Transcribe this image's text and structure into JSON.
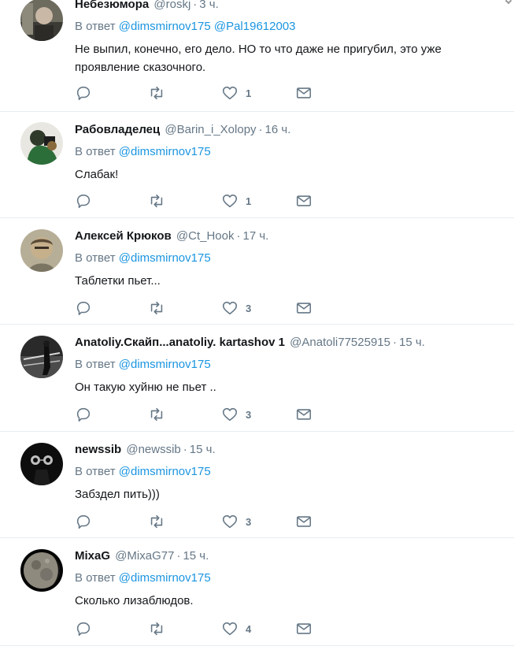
{
  "tweets": [
    {
      "name": "Небезюмора",
      "handle": "@roskj",
      "time": "3 ч.",
      "reply_prefix": "В ответ",
      "mentions": [
        "@dimsmirnov175",
        "@Pal19612003"
      ],
      "text": "Не выпил, конечно, его дело. НО то что даже не пригубил, это уже проявление сказочного.",
      "likes": "1"
    },
    {
      "name": "Рабовладелец",
      "handle": "@Barin_i_Xolopy",
      "time": "16 ч.",
      "reply_prefix": "В ответ",
      "mentions": [
        "@dimsmirnov175"
      ],
      "text": "Слабак!",
      "likes": "1"
    },
    {
      "name": "Алексей Крюков",
      "handle": "@Ct_Hook",
      "time": "17 ч.",
      "reply_prefix": "В ответ",
      "mentions": [
        "@dimsmirnov175"
      ],
      "text": "Таблетки пьет...",
      "likes": "3"
    },
    {
      "name": "Anatoliy.Скайп...anatoliy. kartashov 1",
      "handle": "@Anatoli77525915",
      "time": "15 ч.",
      "reply_prefix": "В ответ",
      "mentions": [
        "@dimsmirnov175"
      ],
      "text": "Он такую хуйню не пьет ..",
      "likes": "3"
    },
    {
      "name": "newssib",
      "handle": "@newssib",
      "time": "15 ч.",
      "reply_prefix": "В ответ",
      "mentions": [
        "@dimsmirnov175"
      ],
      "text": "Забздел пить)))",
      "likes": "3"
    },
    {
      "name": "MixaG",
      "handle": "@MixaG77",
      "time": "15 ч.",
      "reply_prefix": "В ответ",
      "mentions": [
        "@dimsmirnov175"
      ],
      "text": "Сколько лизаблюдов.",
      "likes": "4"
    }
  ],
  "icons": {
    "reply": "reply-icon",
    "retweet": "retweet-icon",
    "like": "heart-icon",
    "dm": "envelope-icon"
  },
  "colors": {
    "name": "#14171a",
    "muted": "#657786",
    "mention": "#1b95e0",
    "divider": "#e6ecf0"
  }
}
